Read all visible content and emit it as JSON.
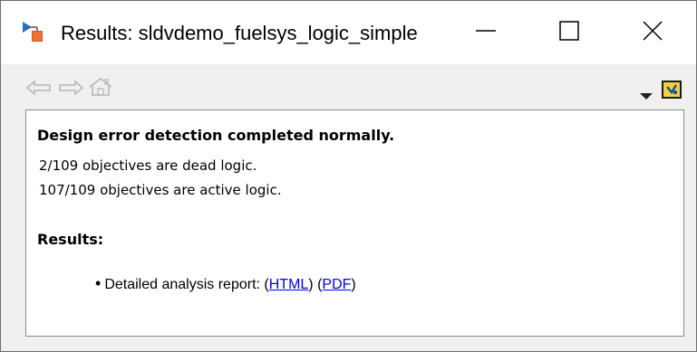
{
  "window": {
    "title": "Results: sldvdemo_fuelsys_logic_simple"
  },
  "titlebar_icons": {
    "app": "simulink-results-icon",
    "minimize": "minimize-icon",
    "maximize": "maximize-icon",
    "close": "close-icon"
  },
  "toolbar": {
    "icons": [
      "back-arrow-icon",
      "forward-arrow-icon",
      "home-icon",
      "dropdown-arrow-icon",
      "help-icon"
    ]
  },
  "content": {
    "heading": "Design error detection completed normally.",
    "line1": "2/109 objectives are dead logic.",
    "line2": "107/109 objectives are active logic.",
    "results_heading": "Results:",
    "report": {
      "bullet": "•",
      "prefix": "Detailed analysis report: (",
      "html_link": "HTML",
      "middle": ") (",
      "pdf_link": "PDF",
      "suffix": ")"
    }
  },
  "colors": {
    "link": "#0000ee",
    "window_bg": "#f0f0f0",
    "content_bg": "#ffffff"
  }
}
